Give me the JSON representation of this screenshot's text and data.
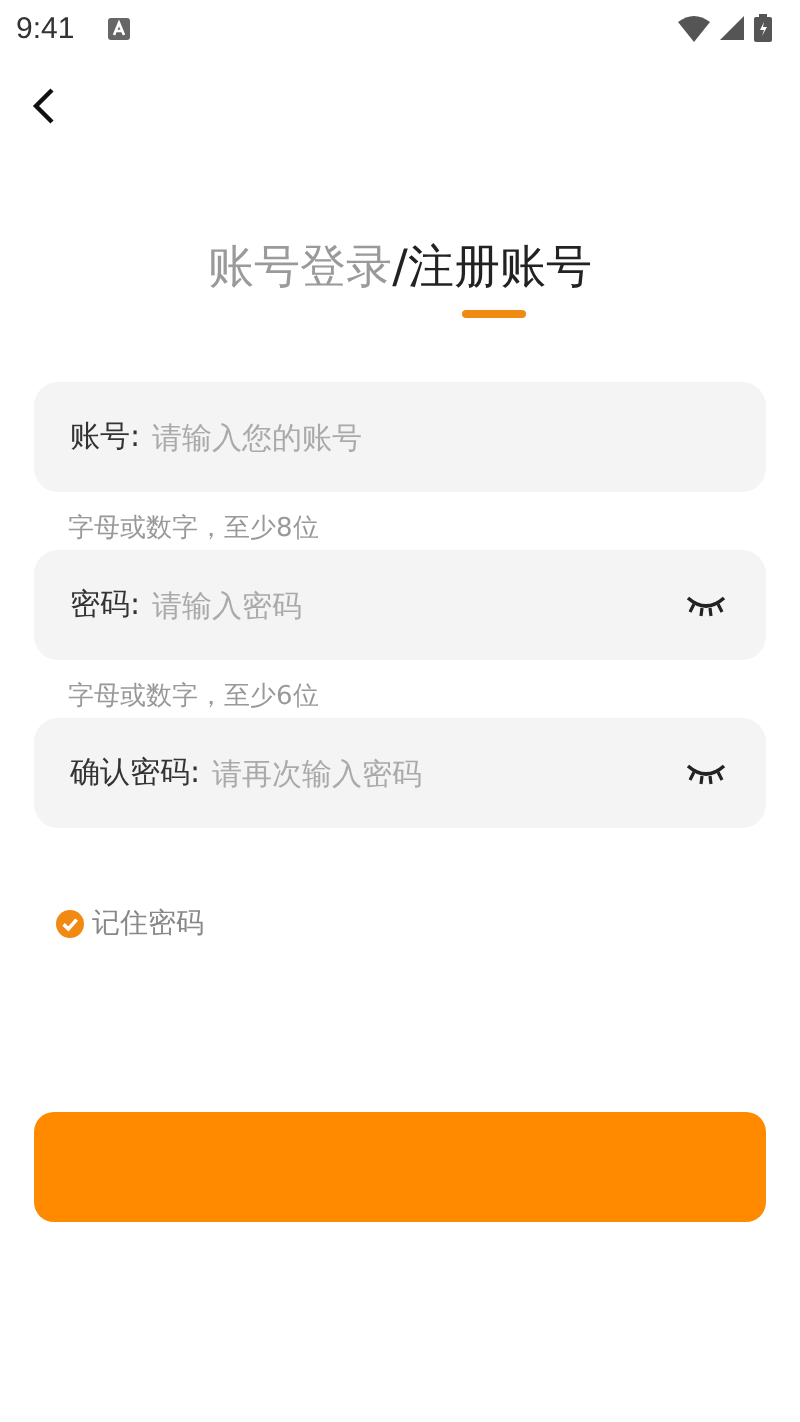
{
  "status_bar": {
    "time": "9:41"
  },
  "tabs": [
    {
      "label": "账号登录",
      "selected": false
    },
    {
      "label": "注册账号",
      "selected": true
    }
  ],
  "tab_separator": "/",
  "fields": [
    {
      "kind": "text",
      "label": "账号:",
      "placeholder": "请输入您的账号",
      "hint": "字母或数字，至少8位"
    },
    {
      "kind": "password",
      "label": "密码:",
      "placeholder": "请输入密码",
      "hint": "字母或数字，至少6位"
    },
    {
      "kind": "password",
      "label": "确认密码:",
      "placeholder": "请再次输入密码"
    }
  ],
  "remember": {
    "label": "记住密码",
    "checked": true
  }
}
